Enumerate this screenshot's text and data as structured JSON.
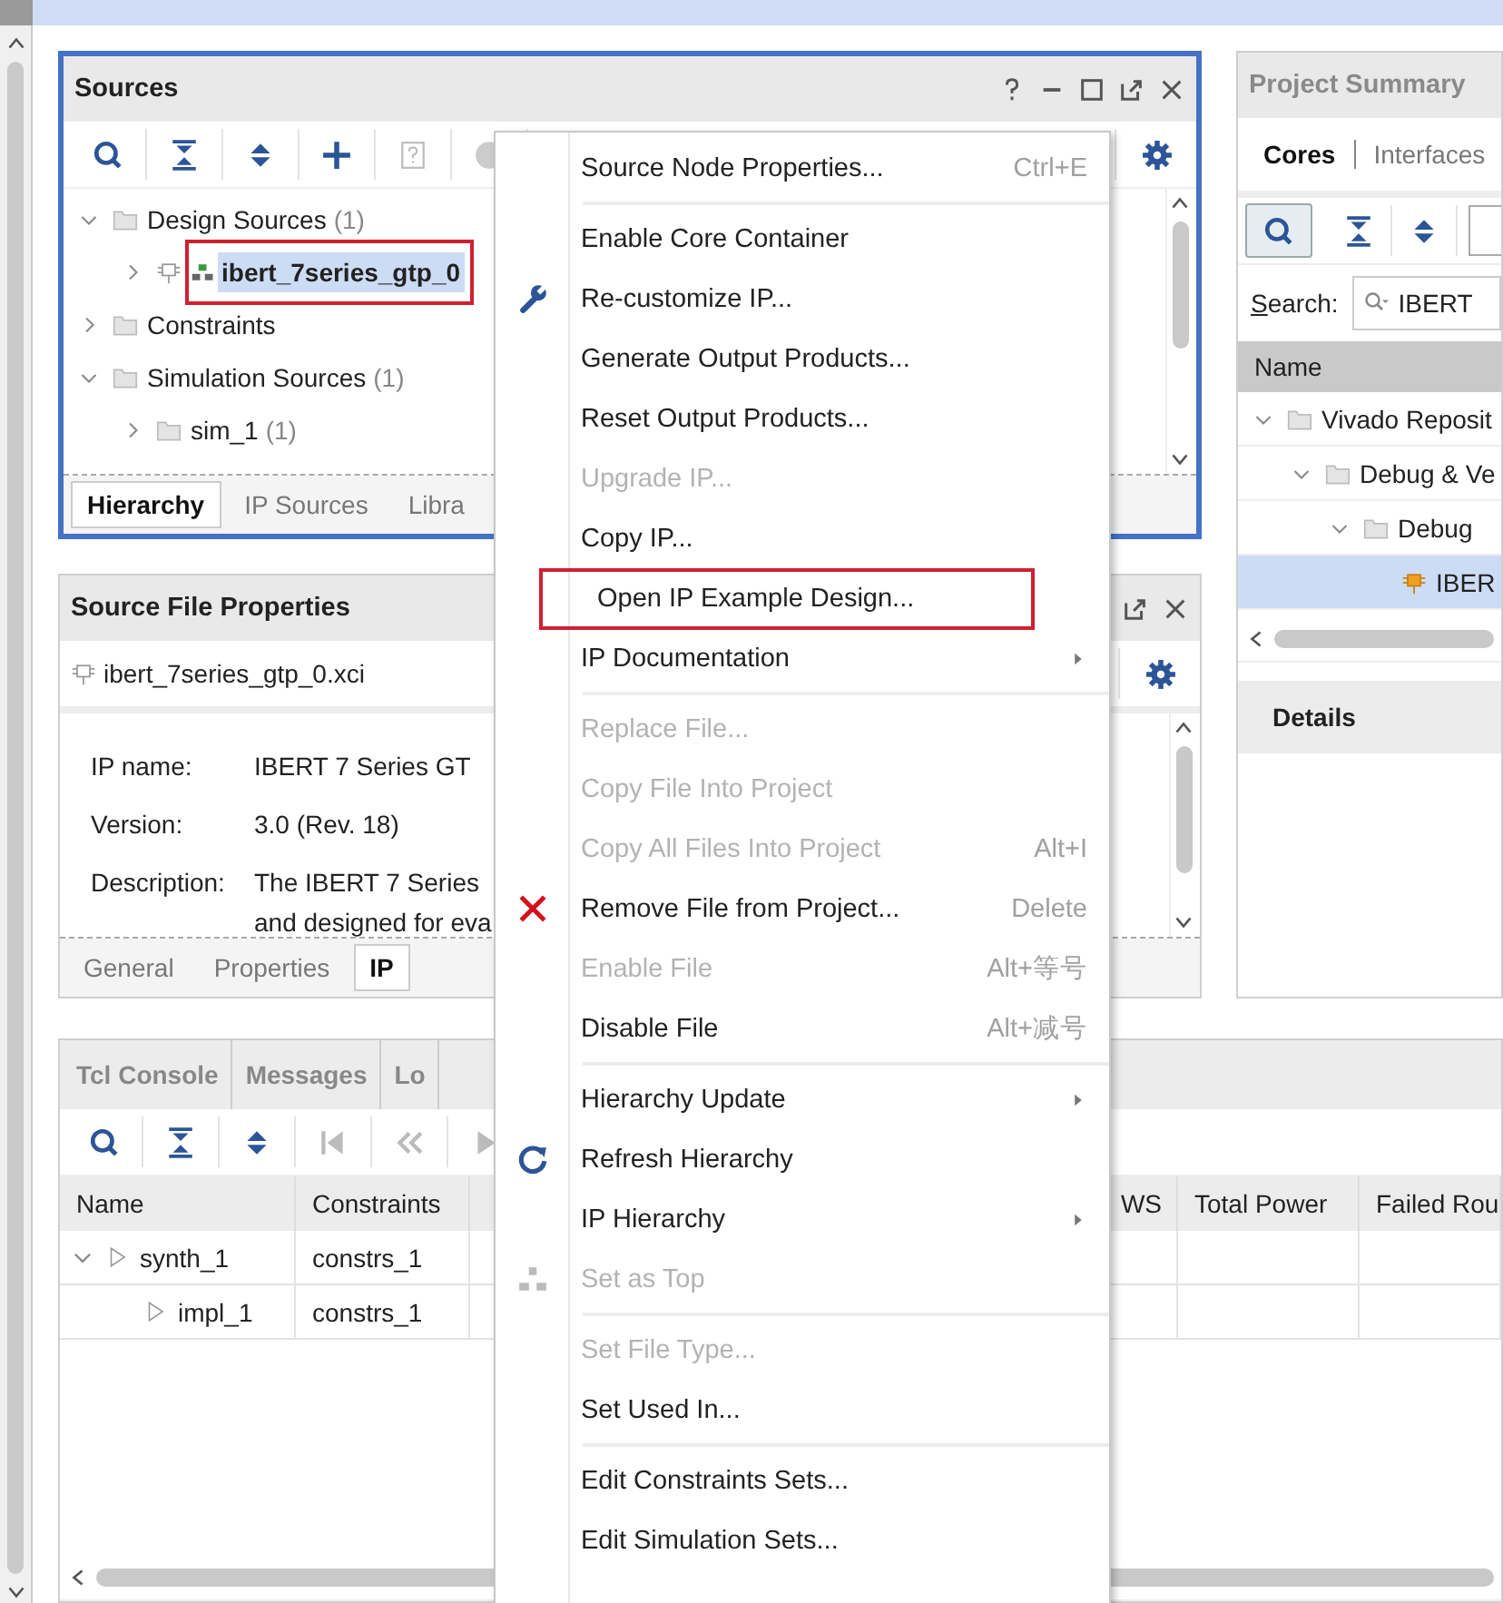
{
  "sources": {
    "title": "Sources",
    "tree": [
      {
        "label": "Design Sources",
        "count": "(1)",
        "kind": "folder",
        "expanded": true,
        "selected": false,
        "highlighted": false,
        "children": [
          {
            "label": "ibert_7series_gtp_0",
            "kind": "ip",
            "expanded": false,
            "selected": true,
            "highlighted": true
          }
        ]
      },
      {
        "label": "Constraints",
        "kind": "folder",
        "expanded": false,
        "selected": false,
        "highlighted": false
      },
      {
        "label": "Simulation Sources",
        "count": "(1)",
        "kind": "folder",
        "expanded": true,
        "selected": false,
        "highlighted": false,
        "children": [
          {
            "label": "sim_1",
            "count": "(1)",
            "kind": "folder",
            "expanded": false,
            "selected": false,
            "highlighted": false
          }
        ]
      }
    ],
    "tabs": [
      {
        "label": "Hierarchy",
        "selected": true
      },
      {
        "label": "IP Sources",
        "selected": false
      },
      {
        "label": "Libra",
        "selected": false
      }
    ]
  },
  "file_properties": {
    "title": "Source File Properties",
    "file": "ibert_7series_gtp_0.xci",
    "properties": [
      {
        "label": "IP name:",
        "lines": [
          "IBERT 7 Series GT"
        ]
      },
      {
        "label": "Version:",
        "lines": [
          "3.0 (Rev. 18)"
        ]
      },
      {
        "label": "Description:",
        "lines": [
          "The IBERT 7 Series",
          "and designed for eva"
        ]
      }
    ],
    "tabs": [
      {
        "label": "General",
        "selected": false
      },
      {
        "label": "Properties",
        "selected": false
      },
      {
        "label": "IP",
        "selected": true
      }
    ]
  },
  "project_summary": {
    "title": "Project Summary",
    "tabs": [
      {
        "label": "Cores",
        "selected": true
      },
      {
        "label": "Interfaces",
        "selected": false
      }
    ],
    "search_label": "Search:",
    "search_value": "IBERT",
    "column": "Name",
    "tree": [
      {
        "label": "Vivado Reposit",
        "kind": "folder",
        "expanded": true,
        "selected": false,
        "children": [
          {
            "label": "Debug & Ve",
            "kind": "folder",
            "expanded": true,
            "selected": false,
            "children": [
              {
                "label": "Debug",
                "kind": "folder",
                "expanded": true,
                "selected": false,
                "children": [
                  {
                    "label": "IBER",
                    "kind": "ip",
                    "selected": true
                  }
                ]
              }
            ]
          }
        ]
      }
    ],
    "details": "Details"
  },
  "console": {
    "tabs": [
      {
        "label": "Tcl Console",
        "selected": false
      },
      {
        "label": "Messages",
        "selected": false
      },
      {
        "label": "Lo",
        "selected": false
      }
    ],
    "columns": [
      "Name",
      "Constraints",
      "WS",
      "Total Power",
      "Failed Rou"
    ],
    "rows": [
      {
        "name": "synth_1",
        "constraints": "constrs_1",
        "expanded": true,
        "children": [
          {
            "name": "impl_1",
            "constraints": "constrs_1"
          }
        ]
      }
    ]
  },
  "context_menu": [
    {
      "kind": "item",
      "label": "Source Node Properties...",
      "shortcut": "Ctrl+E",
      "disabled": false,
      "submenu": false,
      "highlighted": false
    },
    {
      "kind": "separator"
    },
    {
      "kind": "item",
      "label": "Enable Core Container",
      "disabled": false,
      "submenu": false,
      "highlighted": false
    },
    {
      "kind": "customize",
      "label": "Re-customize IP...",
      "disabled": false,
      "submenu": false,
      "highlighted": false
    },
    {
      "kind": "item",
      "label": "Generate Output Products...",
      "disabled": false,
      "submenu": false,
      "highlighted": false
    },
    {
      "kind": "item",
      "label": "Reset Output Products...",
      "disabled": false,
      "submenu": false,
      "highlighted": false
    },
    {
      "kind": "item",
      "label": "Upgrade IP...",
      "disabled": true,
      "submenu": false,
      "highlighted": false
    },
    {
      "kind": "item",
      "label": "Copy IP...",
      "disabled": false,
      "submenu": false,
      "highlighted": false
    },
    {
      "kind": "item",
      "label": "Open IP Example Design...",
      "disabled": false,
      "submenu": false,
      "highlighted": true
    },
    {
      "kind": "item",
      "label": "IP Documentation",
      "disabled": false,
      "submenu": true,
      "highlighted": false
    },
    {
      "kind": "separator"
    },
    {
      "kind": "item",
      "label": "Replace File...",
      "disabled": true,
      "submenu": false,
      "highlighted": false
    },
    {
      "kind": "item",
      "label": "Copy File Into Project",
      "disabled": true,
      "submenu": false,
      "highlighted": false
    },
    {
      "kind": "item",
      "label": "Copy All Files Into Project",
      "shortcut": "Alt+I",
      "disabled": true,
      "submenu": false,
      "highlighted": false
    },
    {
      "kind": "remove",
      "label": "Remove File from Project...",
      "shortcut": "Delete",
      "disabled": false,
      "submenu": false,
      "highlighted": false
    },
    {
      "kind": "item",
      "label": "Enable File",
      "shortcut": "Alt+等号",
      "disabled": true,
      "submenu": false,
      "highlighted": false
    },
    {
      "kind": "item",
      "label": "Disable File",
      "shortcut": "Alt+减号",
      "disabled": false,
      "submenu": false,
      "highlighted": false
    },
    {
      "kind": "separator"
    },
    {
      "kind": "item",
      "label": "Hierarchy Update",
      "disabled": false,
      "submenu": true,
      "highlighted": false
    },
    {
      "kind": "refresh",
      "label": "Refresh Hierarchy",
      "disabled": false,
      "submenu": false,
      "highlighted": false
    },
    {
      "kind": "item",
      "label": "IP Hierarchy",
      "disabled": false,
      "submenu": true,
      "highlighted": false
    },
    {
      "kind": "top",
      "label": "Set as Top",
      "disabled": true,
      "submenu": false,
      "highlighted": false
    },
    {
      "kind": "separator"
    },
    {
      "kind": "item",
      "label": "Set File Type...",
      "disabled": true,
      "submenu": false,
      "highlighted": false
    },
    {
      "kind": "item",
      "label": "Set Used In...",
      "disabled": false,
      "submenu": false,
      "highlighted": false
    },
    {
      "kind": "separator"
    },
    {
      "kind": "item",
      "label": "Edit Constraints Sets...",
      "disabled": false,
      "submenu": false,
      "highlighted": false
    },
    {
      "kind": "item",
      "label": "Edit Simulation Sets...",
      "disabled": false,
      "submenu": false,
      "highlighted": false
    }
  ]
}
